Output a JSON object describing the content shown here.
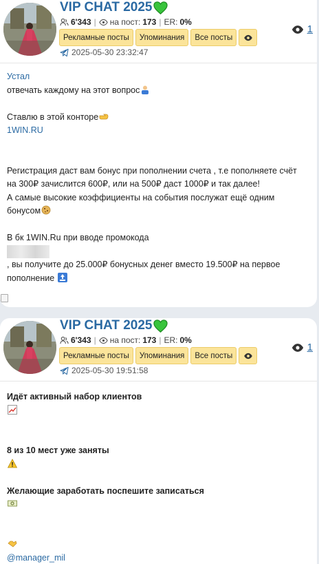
{
  "posts": [
    {
      "channel_title": "VIP CHAT 2025",
      "subscribers": "6'343",
      "views_label": "на пост:",
      "views_per_post": "173",
      "er_label": "ER:",
      "er_value": "0%",
      "buttons": [
        "Рекламные посты",
        "Упоминания",
        "Все посты"
      ],
      "datetime": "2025-05-30 23:32:47",
      "views_count": "1",
      "text": {
        "l1": "Устал",
        "l2": "отвечать каждому на этот вопрос",
        "l3": "Ставлю в этой конторе",
        "l4": "1WIN.RU",
        "l5": "Регистрация даст вам бонус при пополнении счета , т.е пополняете счёт",
        "l6": "на 300₽ зачислится 600₽, или на 500₽ даст 1000₽ и так далее!",
        "l7": "А самые высокие коэффициенты на события послужат ещё одним",
        "l8": "бонусом",
        "l9": "В бк 1WIN.Ru при вводе промокода",
        "l10": ", вы получите до 25.000₽ бонусных денег вместо 19.500₽ на первое",
        "l11": "пополнение"
      }
    },
    {
      "channel_title": "VIP CHAT 2025",
      "subscribers": "6'343",
      "views_label": "на пост:",
      "views_per_post": "173",
      "er_label": "ER:",
      "er_value": "0%",
      "buttons": [
        "Рекламные посты",
        "Упоминания",
        "Все посты"
      ],
      "datetime": "2025-05-30 19:51:58",
      "views_count": "1",
      "text": {
        "l1": "Идёт активный набор клиентов",
        "l2": "8 из 10 мест уже заняты",
        "l3": "Желающие заработать поспешите записаться",
        "l4": "@manager_mil"
      }
    }
  ],
  "colors": {
    "accent": "#2b6aa3",
    "button_bg": "#fbe49a",
    "heart": "#39c43c"
  },
  "icons": [
    "heart-icon",
    "subscribers-icon",
    "eye-icon",
    "telegram-icon",
    "broken-image-icon"
  ]
}
